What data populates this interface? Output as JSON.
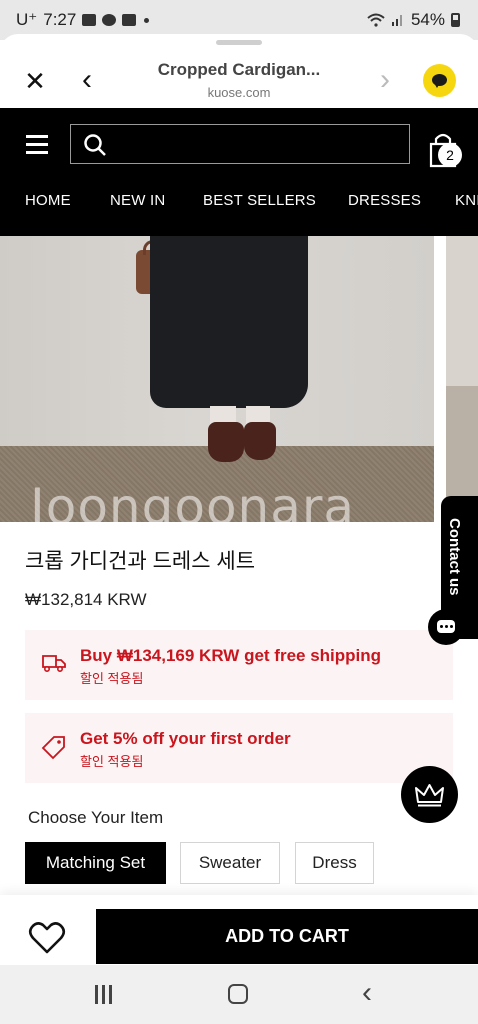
{
  "status_bar": {
    "carrier": "U⁺",
    "time": "7:27",
    "battery": "54%"
  },
  "browser": {
    "title": "Cropped Cardigan...",
    "url": "kuose.com",
    "close_icon": "close-icon",
    "back_icon": "chevron-left-icon",
    "forward_icon": "chevron-right-icon",
    "chat_icon": "kakaotalk-chat-icon",
    "chat_color": "#f6d60f"
  },
  "site_header": {
    "cart_count": "2",
    "nav": [
      "HOME",
      "NEW IN",
      "BEST SELLERS",
      "DRESSES",
      "KNI"
    ]
  },
  "gallery": {
    "watermark": "Joongoonara"
  },
  "product": {
    "title": "크롭 가디건과 드레스 세트",
    "price": "₩132,814 KRW"
  },
  "promos": [
    {
      "main": "Buy ₩134,169 KRW get free shipping",
      "sub": "할인 적용됨",
      "icon": "delivery-truck-icon"
    },
    {
      "main": "Get 5% off your first order",
      "sub": "할인 적용됨",
      "icon": "price-tag-icon"
    }
  ],
  "accent_color": "#c9151e",
  "contact": {
    "label": "Contact us"
  },
  "options": {
    "label": "Choose Your Item",
    "items": [
      "Matching Set",
      "Sweater",
      "Dress"
    ],
    "selected": "Matching Set"
  },
  "actions": {
    "add_to_cart": "ADD TO CART"
  }
}
